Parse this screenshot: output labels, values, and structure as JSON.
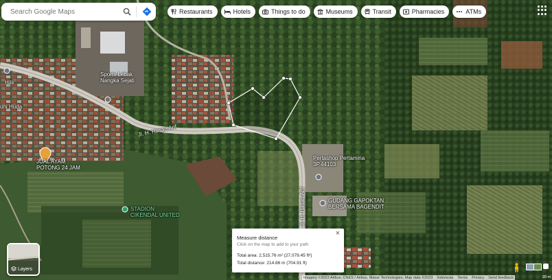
{
  "search": {
    "placeholder": "Search Google Maps"
  },
  "chips": [
    {
      "label": "Restaurants",
      "icon": "restaurant-icon"
    },
    {
      "label": "Hotels",
      "icon": "hotel-icon"
    },
    {
      "label": "Things to do",
      "icon": "camera-icon"
    },
    {
      "label": "Museums",
      "icon": "museum-icon"
    },
    {
      "label": "Transit",
      "icon": "transit-icon"
    },
    {
      "label": "Pharmacies",
      "icon": "pharmacy-icon"
    },
    {
      "label": "ATMs",
      "icon": "atm-icon"
    }
  ],
  "map_labels": {
    "place1": "Sports Lebak",
    "place1b": "Nangka Sejati",
    "hilir": "Hilir",
    "huda": "uni Huda",
    "jual1": "JUAL AYAM",
    "jual2": "POTONG 24 JAM",
    "stadion1": "STADION",
    "stadion2": "CIKENDAL UNITED",
    "road1": "Jl. H. Hasan Arif",
    "road2": "Jl. H. Hasan Arif",
    "pertashop1": "Pertashop Pertamina",
    "pertashop2": "3P.44103",
    "gudang1": "GUDANG GAPOKTAN",
    "gudang2": "BERSAMA BAGENDIT"
  },
  "measure": {
    "title": "Measure distance",
    "hint": "Click on the map to add to your path",
    "area": "Total area: 2,515.76 m² (27,079.45 ft²)",
    "distance": "Total distance: 214.86 m (704.91 ft)"
  },
  "layers": {
    "label": "Layers"
  },
  "footer": {
    "imagery": "Imagery ©2023 Airbus, CNES / Airbus, Maxar Technologies, Map data ©2023",
    "indonesia": "Indonesia",
    "terms": "Terms",
    "privacy": "Privacy",
    "feedback": "Send feedback",
    "scale": "20 m"
  },
  "colors": {
    "road": "#d9d6cf",
    "measure_line": "#ffffff",
    "accent": "#1a73e8"
  }
}
